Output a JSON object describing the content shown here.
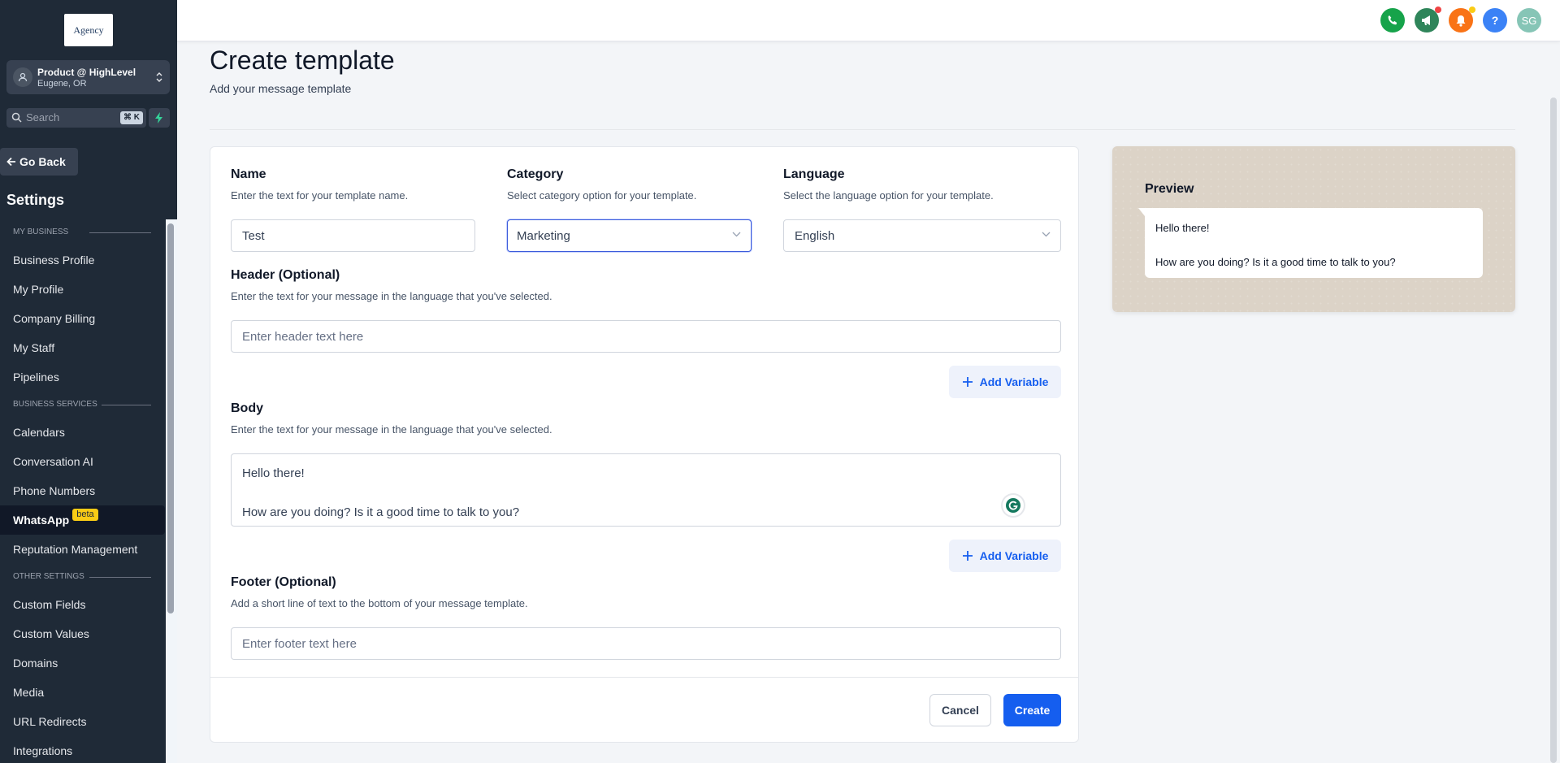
{
  "sidebar": {
    "logo_text": "Agency",
    "account": {
      "name": "Product @ HighLevel",
      "location": "Eugene, OR"
    },
    "search": {
      "placeholder": "Search",
      "shortcut": "⌘ K"
    },
    "go_back": "Go Back",
    "settings_title": "Settings",
    "sections": [
      {
        "title": "MY BUSINESS",
        "items": [
          "Business Profile",
          "My Profile",
          "Company Billing",
          "My Staff",
          "Pipelines"
        ]
      },
      {
        "title": "BUSINESS SERVICES",
        "items": [
          "Calendars",
          "Conversation AI",
          "Phone Numbers",
          "WhatsApp",
          "Reputation Management"
        ]
      },
      {
        "title": "OTHER SETTINGS",
        "items": [
          "Custom Fields",
          "Custom Values",
          "Domains",
          "Media",
          "URL Redirects",
          "Integrations"
        ]
      }
    ],
    "active_item": "WhatsApp",
    "active_badge": "beta"
  },
  "topbar": {
    "avatar_initials": "SG",
    "icons": [
      "phone-icon",
      "megaphone-icon",
      "bell-icon",
      "help-icon"
    ],
    "colors": {
      "phone": "#16a34a",
      "megaphone": "#2f855a",
      "bell": "#f97316",
      "help": "#3b82f6",
      "avatar": "#86c5b6"
    }
  },
  "page": {
    "title": "Create template",
    "subtitle": "Add your message template"
  },
  "form": {
    "name": {
      "label": "Name",
      "hint": "Enter the text for your template name.",
      "value": "Test"
    },
    "category": {
      "label": "Category",
      "hint": "Select category option for your template.",
      "value": "Marketing"
    },
    "language": {
      "label": "Language",
      "hint": "Select the language option for your template.",
      "value": "English"
    },
    "header": {
      "label": "Header (Optional)",
      "hint": "Enter the text for your message in the language that you've selected.",
      "placeholder": "Enter header text here"
    },
    "body": {
      "label": "Body",
      "hint": "Enter the text for your message in the language that you've selected.",
      "line1": "Hello there!",
      "line2": "How are you doing? Is it a good time to talk to you?"
    },
    "footer": {
      "label": "Footer (Optional)",
      "hint": "Add a short line of text to the bottom of your message template.",
      "placeholder": "Enter footer text here"
    },
    "add_variable": "Add Variable",
    "cancel": "Cancel",
    "create": "Create"
  },
  "preview": {
    "title": "Preview",
    "line1": "Hello there!",
    "line2": "How are you doing? Is it a good time to talk to you?"
  }
}
